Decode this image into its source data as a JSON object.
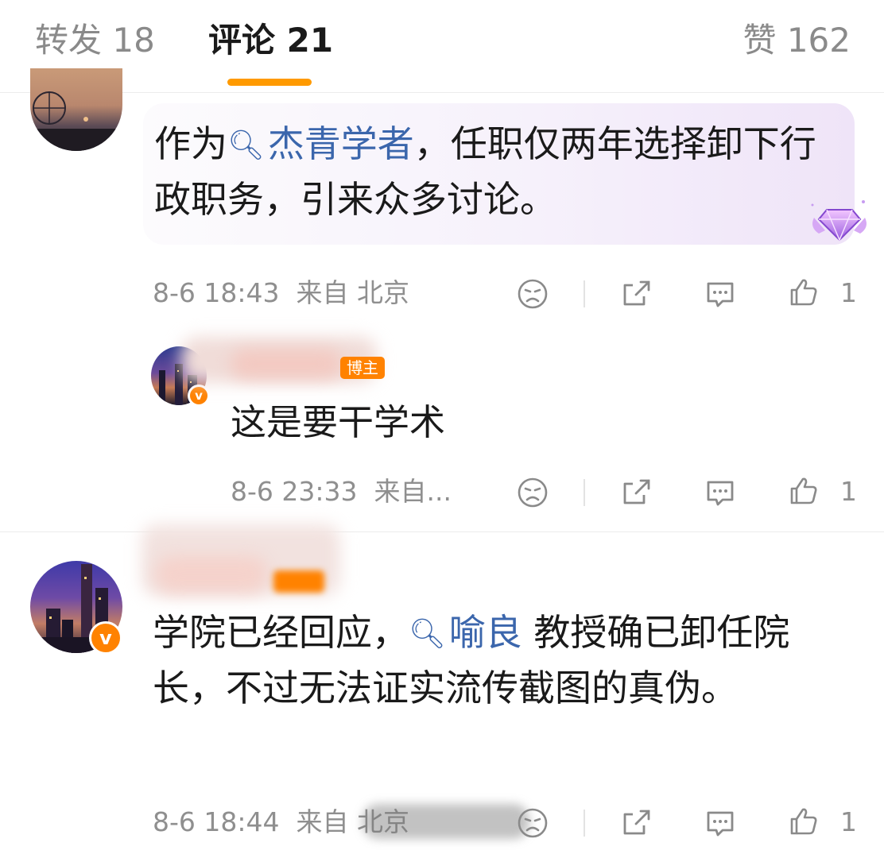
{
  "tabs": {
    "repost": "转发 18",
    "comments": "评论 21",
    "likes": "赞 162"
  },
  "comment1": {
    "text_before": "作为",
    "mention": "杰青学者",
    "text_after": "，任职仅两年选择卸下行政职务，引来众多讨论。",
    "time": "8-6 18:43",
    "from": "来自 北京",
    "likes": "1"
  },
  "reply": {
    "badge": "博主",
    "text": "这是要干学术",
    "time": "8-6 23:33",
    "from": "来自...",
    "likes": "1"
  },
  "comment2": {
    "text_before": "学院已经回应，",
    "mention": "喻良",
    "text_after": " 教授确已卸任院长，不过无法证实流传截图的真伪。",
    "time": "8-6 18:44",
    "from": "来自 北京",
    "likes": "1"
  },
  "colors": {
    "accent": "#ff9a00",
    "mention": "#3b66ac",
    "verified": "#ff8200",
    "meta": "#8f8f8f"
  },
  "icons": [
    "dislike-face-icon",
    "share-icon",
    "reply-comment-icon",
    "thumb-up-icon",
    "verified-v-icon",
    "search-icon",
    "gem-medal-icon"
  ]
}
